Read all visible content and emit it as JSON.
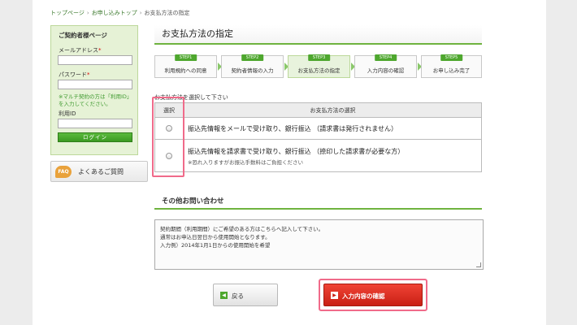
{
  "breadcrumb": {
    "items": [
      "トップページ",
      "お申し込みトップ",
      "お支払方法の指定"
    ],
    "sep": "›"
  },
  "sidebar": {
    "login": {
      "title": "ご契約者様ページ",
      "email_label": "メールアドレス",
      "password_label": "パスワード",
      "required_mark": "*",
      "note": "※マルチ契約の方は「利用ID」を入力してください。",
      "userid_label": "利用ID",
      "login_button": "ログイン"
    },
    "faq": {
      "icon_text": "FAQ",
      "label": "よくあるご質問"
    }
  },
  "main": {
    "title": "お支払方法の指定",
    "steps": [
      {
        "badge": "STEP1",
        "label": "利用規約への同意"
      },
      {
        "badge": "STEP2",
        "label": "契約者情報の入力"
      },
      {
        "badge": "STEP3",
        "label": "お支払方法の指定"
      },
      {
        "badge": "STEP4",
        "label": "入力内容の確認"
      },
      {
        "badge": "STEP5",
        "label": "お申し込み完了"
      }
    ],
    "payment": {
      "instruction": "お支払方法を選択して下さい",
      "col_select": "選択",
      "col_option": "お支払方法の選択",
      "options": [
        {
          "label": "振込先情報をメールで受け取り、銀行振込 （請求書は発行されません）",
          "note": ""
        },
        {
          "label": "振込先情報を請求書で受け取り、銀行振込 （捺印した請求書が必要な方）",
          "note": "※恐れ入りますがお振込手数料はご負担ください"
        }
      ]
    },
    "inquiry": {
      "title": "その他お問い合わせ",
      "placeholder_lines": [
        "契約期間（利用期間）にご希望のある方はこちらへ記入して下さい。",
        "通常はお申込日翌日から使用開始となります。",
        "入力例）2014年1月1日からの使用開始を希望"
      ]
    },
    "buttons": {
      "back": "戻る",
      "confirm": "入力内容の確認"
    }
  },
  "colors": {
    "accent_green": "#4ea72e",
    "highlight_pink": "#f06b8a",
    "confirm_red": "#d9281a"
  }
}
